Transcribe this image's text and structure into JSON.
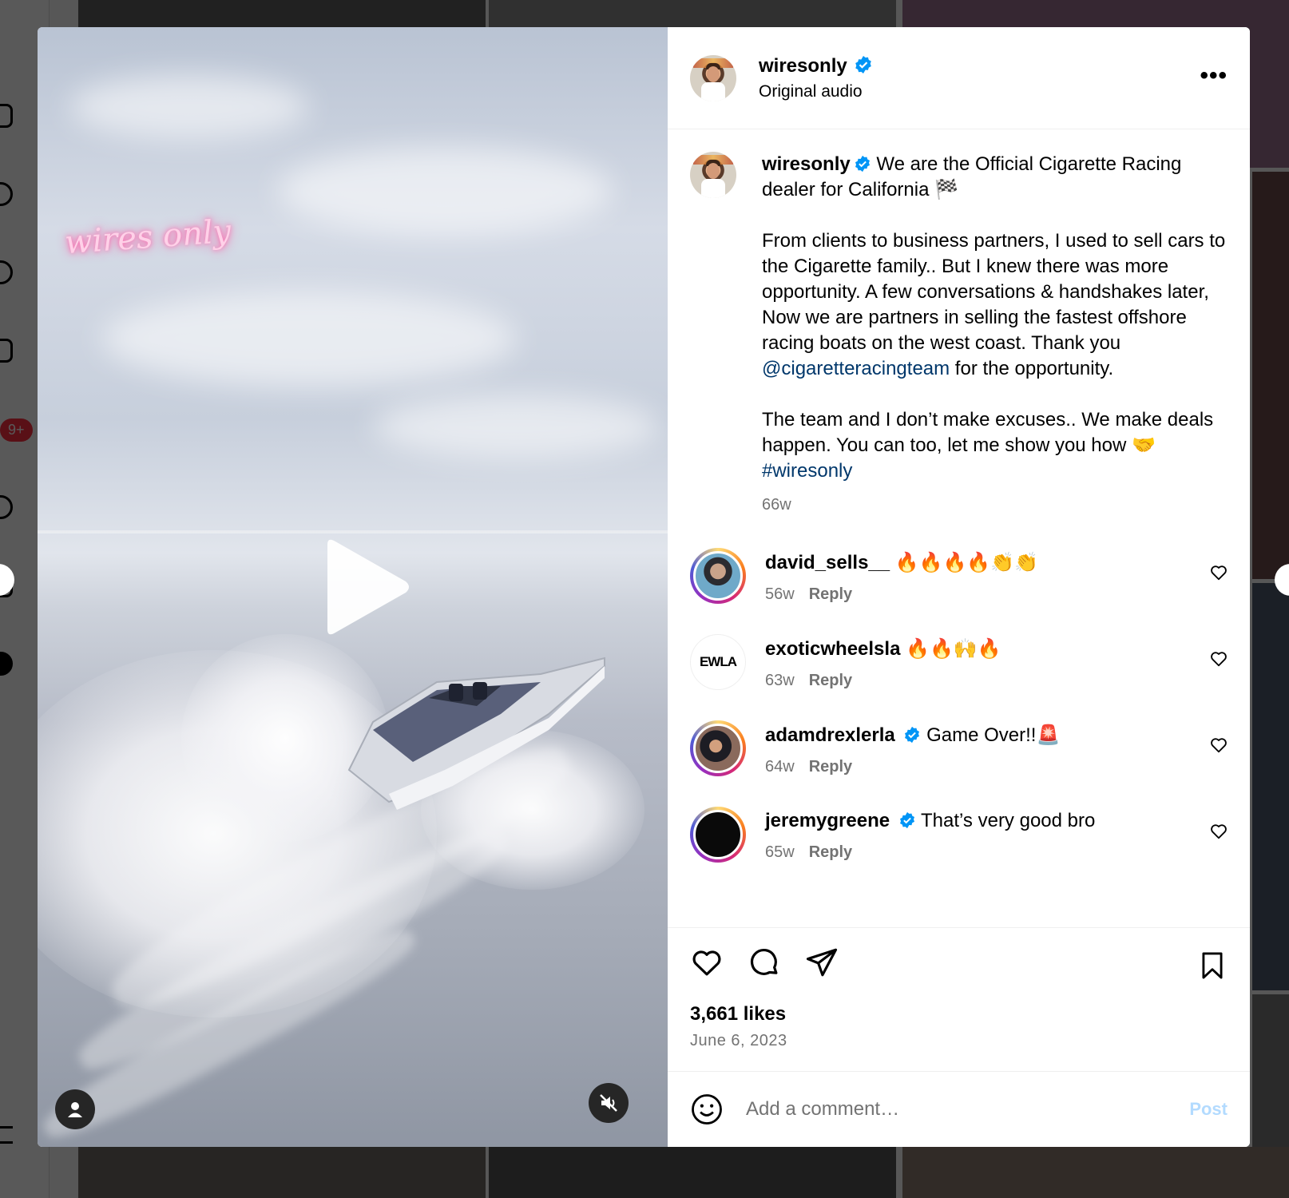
{
  "post": {
    "username": "wiresonly",
    "audio": "Original audio",
    "caption_head": "We are the Official Cigarette Racing dealer for California 🏁",
    "caption_p1_a": "From clients to business partners, I used to sell cars to the Cigarette family.. But I knew there was more opportunity. A few conversations & handshakes later, Now we are partners in selling the fastest offshore racing boats on the west coast. Thank you ",
    "caption_mention": "@cigaretteracingteam",
    "caption_p1_b": " for the opportunity.",
    "caption_p2_a": "The team and I don’t make excuses.. We make deals happen. You can too, let me show you how 🤝 ",
    "caption_hashtag": "#wiresonly",
    "time": "66w",
    "watermark": "wires only"
  },
  "comments": [
    {
      "username": "david_sells__",
      "text": "🔥🔥🔥🔥👏👏",
      "time": "56w",
      "reply": "Reply",
      "verified": false
    },
    {
      "username": "exoticwheelsla",
      "text": "🔥🔥🙌🔥",
      "time": "63w",
      "reply": "Reply",
      "verified": false,
      "avatar_text": "EWLA"
    },
    {
      "username": "adamdrexlerla",
      "text": "Game Over!!🚨",
      "time": "64w",
      "reply": "Reply",
      "verified": true
    },
    {
      "username": "jeremygreene",
      "text": "That’s very good bro",
      "time": "65w",
      "reply": "Reply",
      "verified": true
    }
  ],
  "stats": {
    "likes": "3,661 likes",
    "date": "June 6, 2023"
  },
  "composer": {
    "placeholder": "Add a comment…",
    "post_label": "Post"
  },
  "background": {
    "notification_badge": "9+"
  },
  "colors": {
    "verified": "#0095f6",
    "link": "#00376b",
    "secondary_text": "#737373",
    "post_button_disabled": "#b3dbff"
  }
}
